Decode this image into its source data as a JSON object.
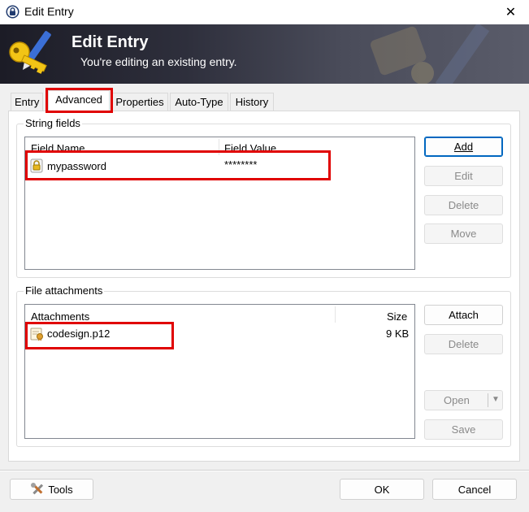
{
  "window": {
    "title": "Edit Entry",
    "close_glyph": "✕"
  },
  "banner": {
    "title": "Edit Entry",
    "subtitle": "You're editing an existing entry."
  },
  "tabs": [
    {
      "label": "Entry"
    },
    {
      "label": "Advanced"
    },
    {
      "label": "Properties"
    },
    {
      "label": "Auto-Type"
    },
    {
      "label": "History"
    }
  ],
  "string_fields": {
    "group_label": "String fields",
    "columns": [
      "Field Name",
      "Field Value"
    ],
    "rows": [
      {
        "name": "mypassword",
        "value": "********",
        "icon": "lock-icon"
      }
    ],
    "buttons": {
      "add": "Add",
      "edit": "Edit",
      "delete": "Delete",
      "move": "Move"
    }
  },
  "file_attachments": {
    "group_label": "File attachments",
    "columns": [
      "Attachments",
      "Size"
    ],
    "rows": [
      {
        "name": "codesign.p12",
        "size": "9 KB",
        "icon": "certificate-icon"
      }
    ],
    "buttons": {
      "attach": "Attach",
      "delete": "Delete",
      "open": "Open",
      "save": "Save"
    }
  },
  "footer": {
    "tools": "Tools",
    "ok": "OK",
    "cancel": "Cancel"
  },
  "colors": {
    "highlight": "#e00000",
    "accent": "#0067c0"
  }
}
